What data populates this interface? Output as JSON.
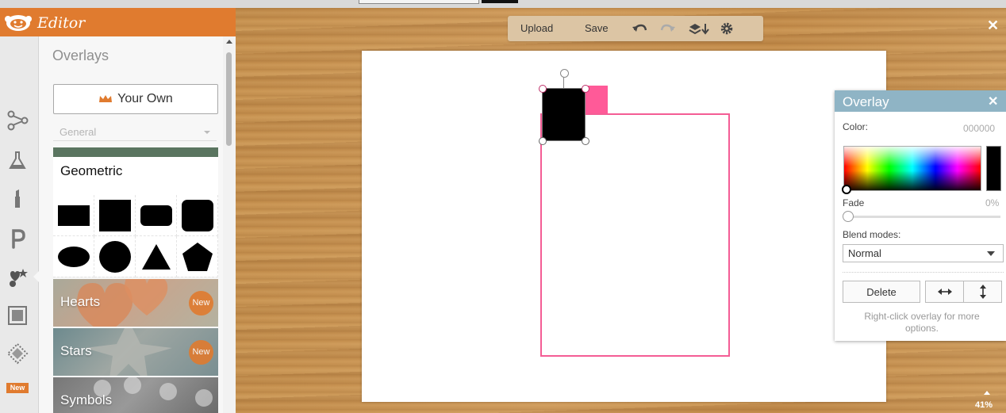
{
  "app": {
    "title": "Editor"
  },
  "panel": {
    "title": "Overlays",
    "your_own_label": "Your Own",
    "category_select": "General",
    "geometric_title": "Geometric",
    "categories": [
      {
        "label": "Hearts",
        "badge": "New"
      },
      {
        "label": "Stars",
        "badge": "New"
      },
      {
        "label": "Symbols",
        "badge": ""
      }
    ]
  },
  "sidebar": {
    "icons": [
      "effects-icon",
      "flask-icon",
      "touch-up-icon",
      "text-icon",
      "overlays-icon",
      "frames-icon",
      "textures-icon"
    ],
    "new_badge": "New"
  },
  "toolbar": {
    "upload_label": "Upload",
    "save_label": "Save"
  },
  "overlay_panel": {
    "title": "Overlay",
    "color_label": "Color:",
    "color_value": "000000",
    "fade_label": "Fade",
    "fade_value": "0%",
    "blend_label": "Blend modes:",
    "blend_selected": "Normal",
    "delete_label": "Delete",
    "hint": "Right-click overlay for more options."
  },
  "zoom": {
    "value": "41%"
  },
  "colors": {
    "brand": "#e07b2f",
    "overlay_header": "#8fb4c5",
    "pink": "#ff5a98",
    "selected_color": "#000000"
  }
}
